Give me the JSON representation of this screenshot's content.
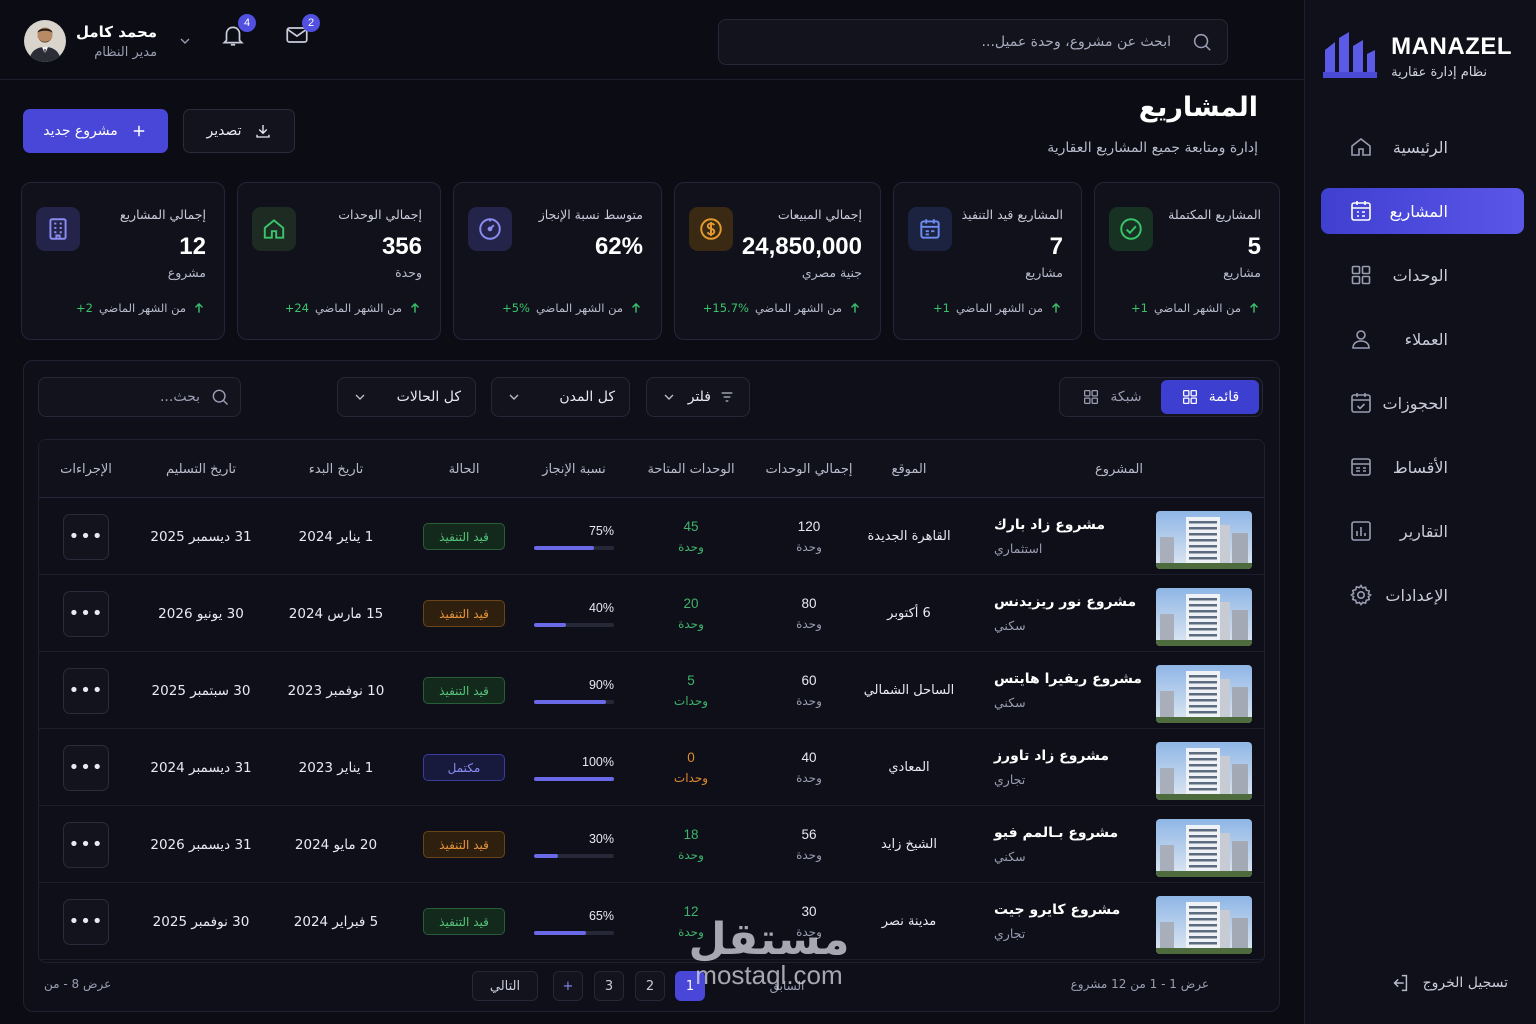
{
  "brand": {
    "name": "MANAZEL",
    "subtitle": "نظام إدارة عقارية"
  },
  "nav": [
    {
      "label": "الرئيسية",
      "icon": "home-icon",
      "active": false
    },
    {
      "label": "المشاريع",
      "icon": "projects-icon",
      "active": true
    },
    {
      "label": "الوحدات",
      "icon": "grid-icon",
      "active": false
    },
    {
      "label": "العملاء",
      "icon": "user-icon",
      "active": false
    },
    {
      "label": "الحجوزات",
      "icon": "calendar-check-icon",
      "active": false
    },
    {
      "label": "الأقساط",
      "icon": "installments-icon",
      "active": false
    },
    {
      "label": "التقارير",
      "icon": "reports-icon",
      "active": false
    },
    {
      "label": "الإعدادات",
      "icon": "gear-icon",
      "active": false
    }
  ],
  "logout": "تسجيل الخروج",
  "topbar": {
    "search_placeholder": "ابحث عن مشروع، وحدة عميل...",
    "notifications_count": "4",
    "messages_count": "2",
    "user_name": "محمد كامل",
    "user_role": "مدير النظام"
  },
  "header": {
    "title": "المشاريع",
    "subtitle": "إدارة ومتابعة جميع المشاريع العقارية",
    "new_project": "مشروع جديد",
    "export": "تصدير"
  },
  "stats": [
    {
      "label": "المشاريع المكتملة",
      "value": "5",
      "unit": "مشاريع",
      "trend_text": "من الشهر الماضي",
      "trend_delta": "1+",
      "icon": "check-circle-icon",
      "accent": "#39c46a"
    },
    {
      "label": "المشاريع قيد التنفيذ",
      "value": "7",
      "unit": "مشاريع",
      "trend_text": "من الشهر الماضي",
      "trend_delta": "1+",
      "icon": "calendar-icon",
      "accent": "#6f8cf0"
    },
    {
      "label": "إجمالي المبيعات",
      "value": "24,850,000",
      "unit": "جنية مصري",
      "trend_text": "من الشهر الماضي",
      "trend_delta": "15.7%+",
      "icon": "dollar-coin-icon",
      "accent": "#e39a2e"
    },
    {
      "label": "متوسط نسبة الإنجاز",
      "value": "62%",
      "unit": "",
      "trend_text": "من الشهر الماضي",
      "trend_delta": "5%+",
      "icon": "gauge-icon",
      "accent": "#7e7ef0"
    },
    {
      "label": "إجمالي الوحدات",
      "value": "356",
      "unit": "وحدة",
      "trend_text": "من الشهر الماضي",
      "trend_delta": "24+",
      "icon": "home-icon",
      "accent": "#39c46a"
    },
    {
      "label": "إجمالي المشاريع",
      "value": "12",
      "unit": "مشروع",
      "trend_text": "من الشهر الماضي",
      "trend_delta": "2+",
      "icon": "building-icon",
      "accent": "#7e7ef0"
    }
  ],
  "toolbar": {
    "view_list": "قائمة",
    "view_grid": "شبكة",
    "filter": "فلتر",
    "cities": "كل المدن",
    "statuses": "كل الحالات",
    "search_placeholder": "بحث..."
  },
  "table": {
    "headers": {
      "project": "المشروع",
      "location": "الموقع",
      "total_units": "إجمالي الوحدات",
      "available_units": "الوحدات المتاحة",
      "progress": "نسبة الإنجاز",
      "status": "الحالة",
      "start_date": "تاريخ البدء",
      "delivery_date": "تاريخ التسليم",
      "actions": "الإجراءات"
    },
    "rows": [
      {
        "name": "مشروع زاد بارك",
        "type": "استثماري",
        "location": "القاهرة الجديدة",
        "total": "120",
        "total_unit": "وحدة",
        "available": "45",
        "available_unit": "وحدة",
        "available_tone": "green",
        "progress": 75,
        "progress_label": "75%",
        "status": "قيد التنفيذ",
        "status_tone": "green",
        "start": "1 يناير 2024",
        "delivery": "31 ديسمبر 2025",
        "actions": "•••"
      },
      {
        "name": "مشروع نور ريزيدنس",
        "type": "سكني",
        "location": "6 أكتوبر",
        "total": "80",
        "total_unit": "وحدة",
        "available": "20",
        "available_unit": "وحدة",
        "available_tone": "green",
        "progress": 40,
        "progress_label": "40%",
        "status": "قيد التنفيذ",
        "status_tone": "orange",
        "start": "15 مارس 2024",
        "delivery": "30 يونيو 2026",
        "actions": "•••"
      },
      {
        "name": "مشروع ريفيرا هايتس",
        "type": "سكني",
        "location": "الساحل الشمالي",
        "total": "60",
        "total_unit": "وحدة",
        "available": "5",
        "available_unit": "وحدات",
        "available_tone": "green",
        "progress": 90,
        "progress_label": "90%",
        "status": "قيد التنفيذ",
        "status_tone": "green",
        "start": "10 نوفمبر 2023",
        "delivery": "30 سبتمبر 2025",
        "actions": "•••"
      },
      {
        "name": "مشروع زاد تاورز",
        "type": "تجاري",
        "location": "المعادي",
        "total": "40",
        "total_unit": "وحدة",
        "available": "0",
        "available_unit": "وحدات",
        "available_tone": "orange",
        "progress": 100,
        "progress_label": "100%",
        "status": "مكتمل",
        "status_tone": "blue",
        "start": "1 يناير 2023",
        "delivery": "31 ديسمبر 2024",
        "actions": "•••"
      },
      {
        "name": "مشروع بـالمم فيو",
        "type": "سكني",
        "location": "الشيخ زايد",
        "total": "56",
        "total_unit": "وحدة",
        "available": "18",
        "available_unit": "وحدة",
        "available_tone": "green",
        "progress": 30,
        "progress_label": "30%",
        "status": "قيد التنفيذ",
        "status_tone": "orange",
        "start": "20 مايو 2024",
        "delivery": "31 ديسمبر 2026",
        "actions": "•••"
      },
      {
        "name": "مشروع كايرو جيت",
        "type": "تجاري",
        "location": "مدينة نصر",
        "total": "30",
        "total_unit": "وحدة",
        "available": "12",
        "available_unit": "وحدة",
        "available_tone": "green",
        "progress": 65,
        "progress_label": "65%",
        "status": "قيد التنفيذ",
        "status_tone": "green",
        "start": "5 فبراير 2024",
        "delivery": "30 نوفمبر 2025",
        "actions": "•••"
      }
    ]
  },
  "pagination": {
    "info": "عرض 1 - 1 من 12 مشروع",
    "info_left": "عرض 8 - من",
    "prev": "السابق",
    "pages": [
      "1",
      "2",
      "3"
    ],
    "current": "1",
    "more": "+",
    "next": "التالي"
  },
  "watermark": {
    "arabic": "مستقل",
    "latin": "mostaql.com"
  }
}
